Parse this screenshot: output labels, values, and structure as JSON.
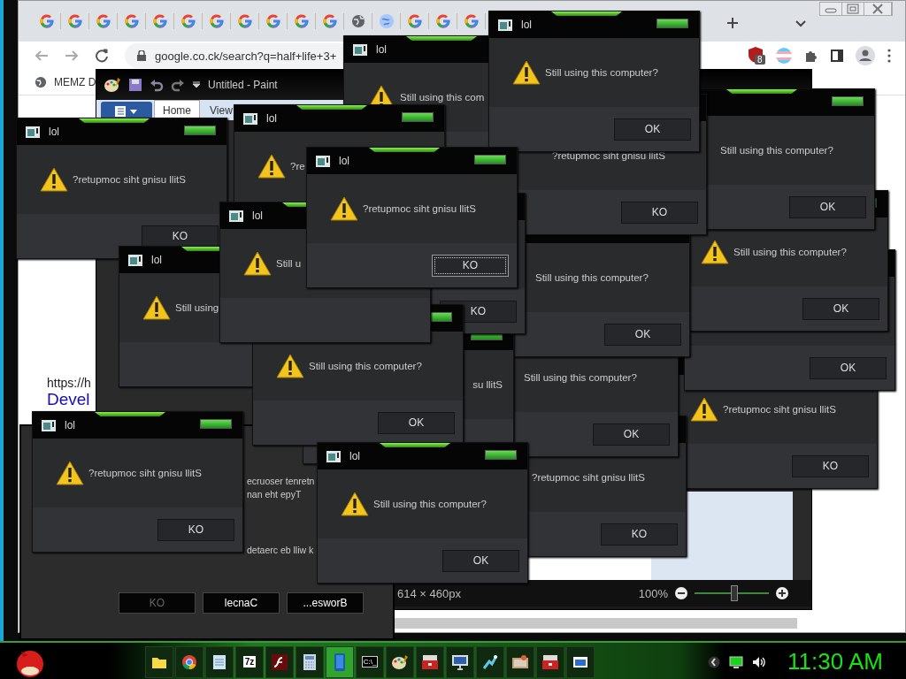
{
  "browser": {
    "address": "google.co.ck/search?q=half+life+3+",
    "bookmark": "MEMZ D",
    "extension_badge": "8",
    "url_line": "https://h",
    "link": "Devel"
  },
  "paint": {
    "title": "Untitled - Paint",
    "tabs": [
      {
        "label": "Home",
        "selected": true
      },
      {
        "label": "View",
        "selected": false
      }
    ],
    "size": "614 × 460px",
    "zoom": "100%",
    "zoom_slider": {
      "level": 0.52
    }
  },
  "run_dialog": {
    "lines": [
      "ecruoser tenretn",
      "nan eht epyT",
      "detaerc eb lliw k"
    ],
    "buttons": [
      {
        "label": "KO",
        "disabled": true
      },
      {
        "label": "lecnaC",
        "disabled": false
      },
      {
        "label": "...esworB",
        "disabled": false
      }
    ]
  },
  "dialogs": [
    {
      "title": "lol",
      "icon": true,
      "message": "Still using this com"
    },
    {
      "title": "lol",
      "icon": true,
      "message": "Still using this computer?",
      "button": "OK",
      "focused": false
    },
    {
      "icon": false,
      "message": "Still using this computer?",
      "button": "OK",
      "focused": false
    },
    {
      "icon": false,
      "message": "?retupmoc siht gnisu llitS",
      "button": "KO",
      "focused": false
    },
    {
      "title": "lol",
      "icon": true,
      "message": "?re"
    },
    {
      "title": "lol",
      "icon": true,
      "message": "?retupmoc siht gnisu llitS",
      "button": "KO",
      "focused": false
    },
    {
      "title": "lol",
      "icon": true,
      "message": "?retupmoc siht gnisu llitS",
      "button": "KO",
      "focused": true
    },
    {
      "icon": false,
      "button": "KO",
      "focused": false
    },
    {
      "icon": true,
      "message": "Still using this computer?",
      "button": "OK",
      "focused": false
    },
    {
      "title": "lol",
      "icon": true,
      "message": "Still u"
    },
    {
      "icon": false,
      "message": "Still using this computer?",
      "button": "OK",
      "focused": false
    },
    {
      "title": "lol",
      "icon": true,
      "message": "Still using"
    },
    {
      "icon": false,
      "button": "OK",
      "focused": false
    },
    {
      "icon": true,
      "message": "Still using this computer?",
      "button": "OK",
      "focused": false
    },
    {
      "icon": false,
      "message": "Still using this computer?",
      "button": "OK",
      "focused": false
    },
    {
      "icon": false,
      "message": "su llitS"
    },
    {
      "icon": true,
      "message": "?retupmoc siht gnisu llitS",
      "button": "KO",
      "focused": false
    },
    {
      "title": "lol",
      "icon": true,
      "message": "?retupmoc siht gnisu llitS",
      "button": "KO",
      "focused": false
    },
    {
      "title": "lol",
      "icon": true,
      "message": "Still using this computer?",
      "button": "OK",
      "focused": false
    },
    {
      "icon": false,
      "message": "?retupmoc siht gnisu llitS",
      "button": "KO",
      "focused": false
    }
  ],
  "taskbar": {
    "apps": [
      {
        "kind": "folder",
        "selected": false
      },
      {
        "kind": "browser",
        "selected": false
      },
      {
        "kind": "notepad",
        "selected": false
      },
      {
        "kind": "archive",
        "label": "7z",
        "selected": false
      },
      {
        "kind": "flash",
        "selected": false
      },
      {
        "kind": "calculator",
        "selected": false
      },
      {
        "kind": "phone",
        "selected": true
      },
      {
        "kind": "terminal",
        "label": "C:\\_",
        "selected": false
      },
      {
        "kind": "paint",
        "selected": false
      },
      {
        "kind": "toolbox",
        "selected": false
      },
      {
        "kind": "monitor",
        "selected": false
      },
      {
        "kind": "sparkle",
        "selected": false
      },
      {
        "kind": "photos",
        "selected": false
      },
      {
        "kind": "toolbox",
        "selected": false
      },
      {
        "kind": "window",
        "selected": false
      }
    ],
    "clock": "11:30 AM"
  }
}
